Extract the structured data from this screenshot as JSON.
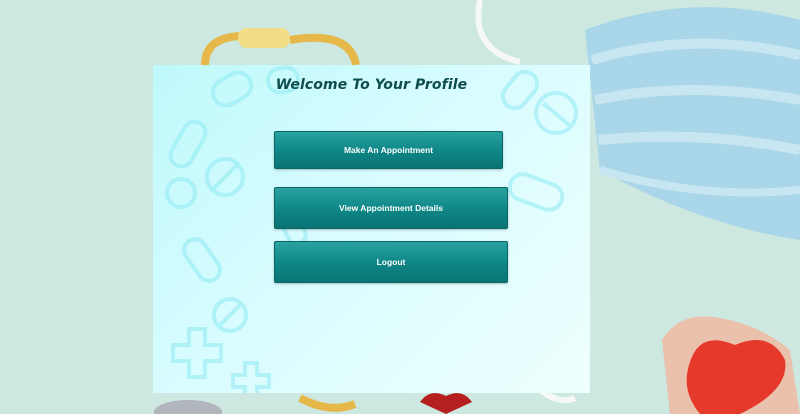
{
  "profile": {
    "title": "Welcome  To Your Profile",
    "buttons": {
      "make_appointment": "Make An Appointment",
      "view_details": "View Appointment  Details",
      "logout": "Logout"
    }
  },
  "colors": {
    "accent": "#0e8586",
    "title": "#0d4d4e",
    "panel": "#d8fcff"
  }
}
